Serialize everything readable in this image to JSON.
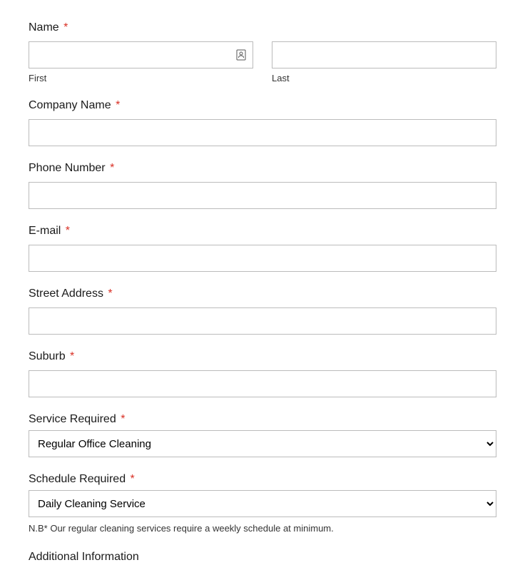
{
  "fields": {
    "name": {
      "label": "Name",
      "first_sublabel": "First",
      "last_sublabel": "Last"
    },
    "company": {
      "label": "Company Name"
    },
    "phone": {
      "label": "Phone Number"
    },
    "email": {
      "label": "E-mail"
    },
    "street": {
      "label": "Street Address"
    },
    "suburb": {
      "label": "Suburb"
    },
    "service": {
      "label": "Service Required",
      "selected": "Regular Office Cleaning"
    },
    "schedule": {
      "label": "Schedule Required",
      "selected": "Daily Cleaning Service",
      "hint": "N.B* Our regular cleaning services require a weekly schedule at minimum."
    },
    "additional": {
      "label": "Additional Information"
    }
  },
  "required_marker": "*"
}
